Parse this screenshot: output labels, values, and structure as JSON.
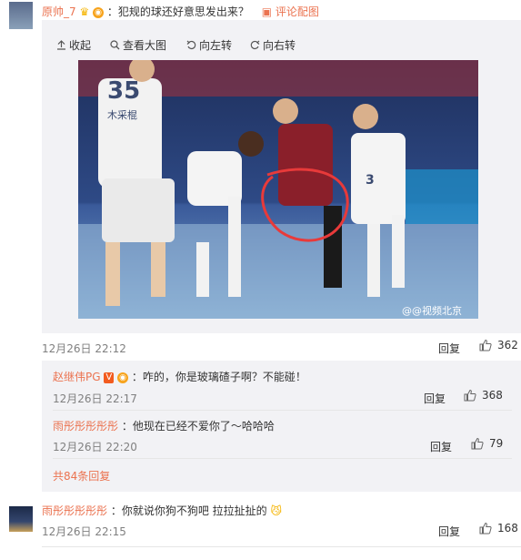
{
  "top_comment": {
    "username": "原帅_7",
    "text": "：犯规的球还好意思发出来？",
    "extra_link": "评论配图"
  },
  "image_toolbar": {
    "collapse": "收起",
    "view_large": "查看大图",
    "rotate_left": "向左转",
    "rotate_right": "向右转"
  },
  "image": {
    "jersey_left": "35",
    "jersey_left_text": "木采棍",
    "jersey_right": "3",
    "watermark": "@@视频北京"
  },
  "main_comment": {
    "timestamp": "12月26日 22:12",
    "reply_label": "回复",
    "likes": "362"
  },
  "replies": [
    {
      "username": "赵继伟PG",
      "vip": "V",
      "text": "：咋的，你是玻璃碴子啊？不能碰！",
      "timestamp": "12月26日 22:17",
      "reply_label": "回复",
      "likes": "368"
    },
    {
      "username": "雨彤彤彤彤彤",
      "text": "：他现在已经不爱你了～哈哈哈",
      "timestamp": "12月26日 22:20",
      "reply_label": "回复",
      "likes": "79"
    }
  ],
  "more_replies": "共84条回复",
  "second_comment": {
    "username": "雨彤彤彤彤彤",
    "text": "：你就说你狗不狗吧 拉拉扯扯的",
    "timestamp": "12月26日 22:15",
    "reply_label": "回复",
    "likes": "168"
  },
  "colors": {
    "username": "#eb7350",
    "panel_bg": "#f2f2f5",
    "circle": "#e83a3a"
  }
}
